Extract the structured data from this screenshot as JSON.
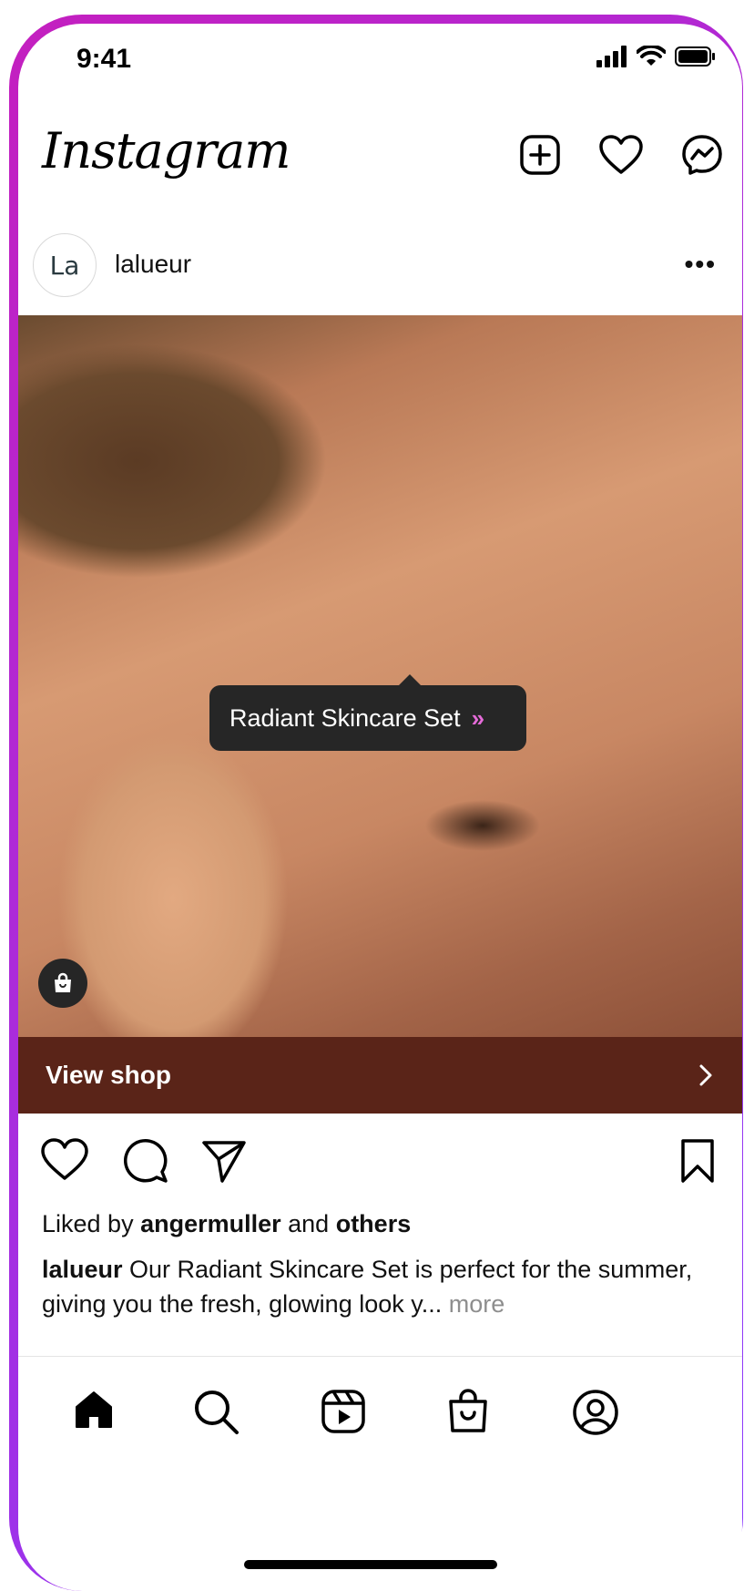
{
  "status_bar": {
    "time": "9:41"
  },
  "header": {
    "logo_text": "Instagram"
  },
  "post": {
    "avatar_text": "La",
    "username": "lalueur",
    "product_tag": "Radiant Skincare Set",
    "tag_chevron": "»",
    "view_shop": "View shop",
    "view_shop_chevron": "›",
    "likes": {
      "prefix": "Liked by ",
      "user": "angermuller",
      "middle": " and ",
      "others": "others"
    },
    "caption": {
      "user": "lalueur",
      "text": " Our Radiant Skincare Set is perfect for the summer, giving you the fresh, glowing look y...",
      "more": " more"
    }
  },
  "colors": {
    "shop_bar": "#5a2418",
    "tooltip": "#262626",
    "frame_gradient_start": "#c41fbf",
    "frame_gradient_end": "#8a3cff"
  },
  "icons": [
    "signal-icon",
    "wifi-icon",
    "battery-icon",
    "new-post-icon",
    "heart-icon",
    "messenger-icon",
    "more-icon",
    "shopping-bag-icon",
    "like-icon",
    "comment-icon",
    "share-icon",
    "bookmark-icon",
    "home-icon",
    "search-icon",
    "reels-icon",
    "shop-icon",
    "profile-icon"
  ]
}
